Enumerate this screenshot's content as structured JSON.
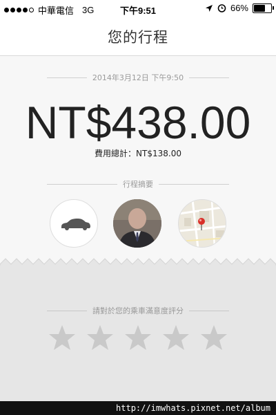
{
  "status_bar": {
    "carrier": "中華電信",
    "network": "3G",
    "time": "下午9:51",
    "battery": "66%",
    "battery_level": 0.66
  },
  "header": {
    "title": "您的行程"
  },
  "receipt": {
    "datetime": "2014年3月12日 下午9:50",
    "fare": "NT$438.00",
    "subtotal": "費用總計：NT$138.00",
    "summary_label": "行程摘要"
  },
  "rating": {
    "prompt": "請對於您的乘車滿意度評分",
    "stars": 5,
    "selected": 0
  },
  "watermark": "http://imwhats.pixnet.net/album",
  "icons": [
    "car-icon",
    "driver-photo",
    "map-icon",
    "location-arrow-icon",
    "alarm-icon",
    "star-icon"
  ],
  "colors": {
    "star": "#c9c9c9",
    "map_pin": "#d9302a"
  }
}
